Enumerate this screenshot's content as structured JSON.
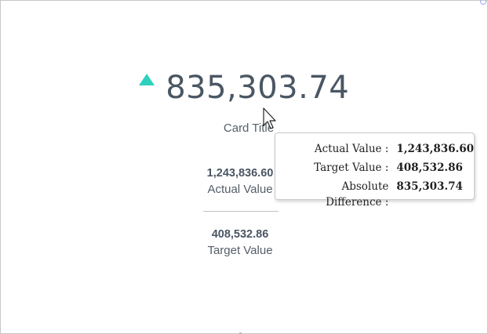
{
  "kpi": {
    "value": "835,303.74",
    "trend": "up",
    "trend_color": "#2ed1be",
    "title": "Card Title"
  },
  "actual": {
    "value": "1,243,836.60",
    "label": "Actual Value"
  },
  "target": {
    "value": "408,532.86",
    "label": "Target Value"
  },
  "tooltip": {
    "rows": [
      {
        "label": "Actual Value :",
        "value": "1,243,836.60"
      },
      {
        "label": "Target Value :",
        "value": "408,532.86"
      },
      {
        "label": "Absolute Difference :",
        "value": "835,303.74"
      }
    ]
  }
}
